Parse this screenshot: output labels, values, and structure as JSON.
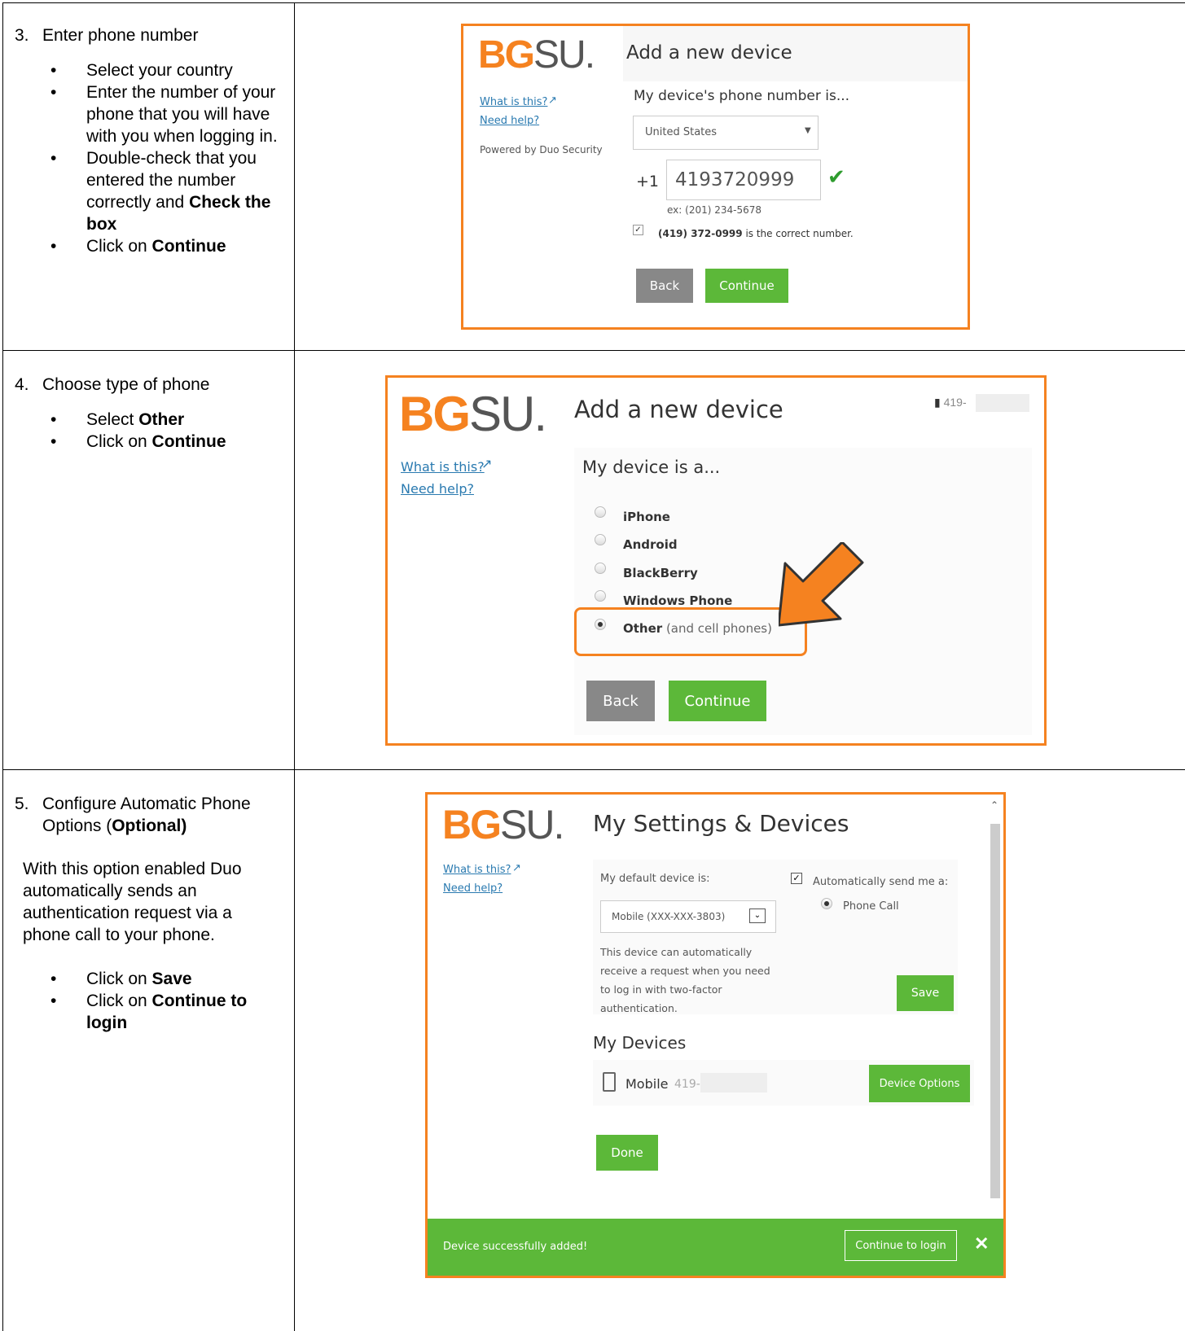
{
  "steps": [
    {
      "number": "3.",
      "title": "Enter phone number",
      "bullets": [
        {
          "pre": "Select your country",
          "bold": "",
          "post": ""
        },
        {
          "pre": "Enter the number of your phone that you will have with you when logging in.",
          "bold": "",
          "post": ""
        },
        {
          "pre": "Double-check that you entered the number correctly and ",
          "bold": "Check the box",
          "post": ""
        },
        {
          "pre": "Click on ",
          "bold": "Continue",
          "post": ""
        }
      ]
    },
    {
      "number": "4.",
      "title": "Choose type of phone",
      "bullets": [
        {
          "pre": "Select ",
          "bold": "Other",
          "post": ""
        },
        {
          "pre": "Click on ",
          "bold": "Continue",
          "post": ""
        }
      ]
    },
    {
      "number": "5.",
      "title_pre": "Configure Automatic Phone Options (",
      "title_bold": "Optional)",
      "paragraph": "With this option enabled Duo automatically sends an authentication request via a phone call to your phone.",
      "bullets": [
        {
          "pre": "Click on ",
          "bold": "Save",
          "post": ""
        },
        {
          "pre": "Click on ",
          "bold": "Continue to login",
          "post": ""
        }
      ]
    }
  ],
  "logo": {
    "bg": "BG",
    "su": "SU",
    "dot": "."
  },
  "links": {
    "what": "What is this?",
    "help": "Need help?",
    "powered": "Powered by Duo Security"
  },
  "shot1": {
    "title": "Add a new device",
    "question": "My device's phone number is...",
    "country": "United States",
    "code": "+1",
    "phone": "4193720999",
    "example": "ex: (201) 234-5678",
    "confirm_bold": "(419) 372-0999",
    "confirm_rest": " is the correct number.",
    "back": "Back",
    "continue": "Continue"
  },
  "shot2": {
    "title": "Add a new device",
    "phone_badge": "419-",
    "question": "My device is a...",
    "options": [
      {
        "label": "iPhone",
        "extra": "",
        "selected": false
      },
      {
        "label": "Android",
        "extra": "",
        "selected": false
      },
      {
        "label": "BlackBerry",
        "extra": "",
        "selected": false
      },
      {
        "label": "Windows Phone",
        "extra": "",
        "selected": false
      },
      {
        "label": "Other",
        "extra": " (and cell phones)",
        "selected": true
      }
    ],
    "back": "Back",
    "continue": "Continue"
  },
  "shot3": {
    "title": "My Settings & Devices",
    "default_label": "My default device is:",
    "device_select": "Mobile (XXX-XXX-3803)",
    "auto_label": "Automatically send me a:",
    "auto_option": "Phone Call",
    "desc": "This device can automatically receive a request when you need to log in with two-factor authentication.",
    "save": "Save",
    "devices_header": "My Devices",
    "device_name": "Mobile",
    "device_num": "419-",
    "device_options": "Device Options",
    "done": "Done",
    "banner": "Device successfully added!",
    "continue_login": "Continue to login"
  },
  "colors": {
    "accent": "#f58220",
    "green": "#5cb839"
  }
}
